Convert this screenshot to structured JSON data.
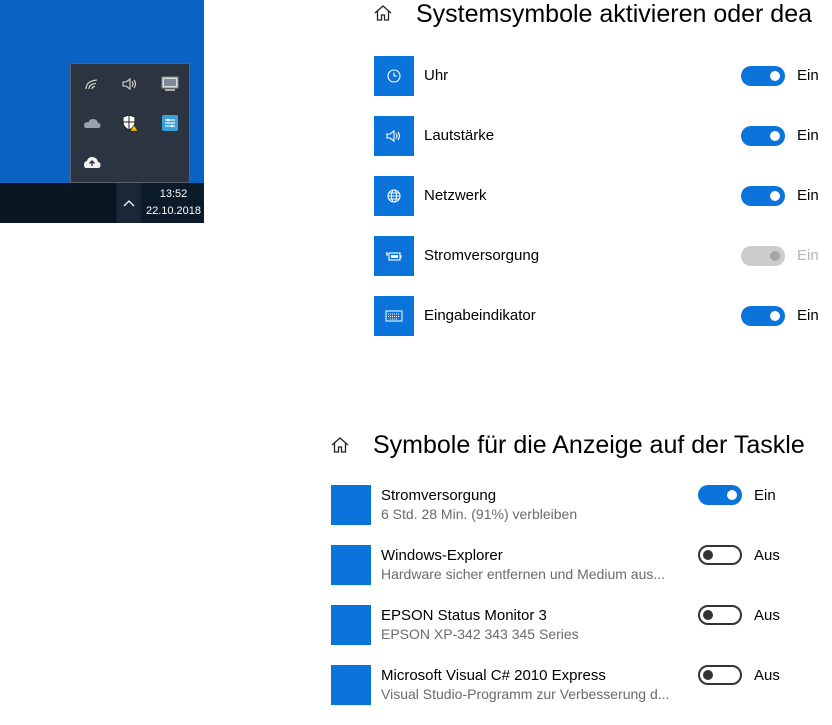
{
  "tray": {
    "time": "13:52",
    "date": "22.10.2018",
    "flyout_icons": [
      "wifi-icon",
      "volume-icon",
      "monitor-icon",
      "onedrive-icon",
      "security-shield-icon",
      "network-app-icon",
      "upload-cloud-icon"
    ]
  },
  "system_icons": {
    "title": "Systemsymbole aktivieren oder dea",
    "items": [
      {
        "label": "Uhr",
        "icon": "clock-icon",
        "state": "Ein",
        "toggle": "on"
      },
      {
        "label": "Lautstärke",
        "icon": "volume-icon",
        "state": "Ein",
        "toggle": "on"
      },
      {
        "label": "Netzwerk",
        "icon": "globe-icon",
        "state": "Ein",
        "toggle": "on"
      },
      {
        "label": "Stromversorgung",
        "icon": "battery-icon",
        "state": "Ein",
        "toggle": "disabled"
      },
      {
        "label": "Eingabeindikator",
        "icon": "keyboard-icon",
        "state": "Ein",
        "toggle": "on"
      }
    ]
  },
  "taskbar_icons": {
    "title": "Symbole für die Anzeige auf der Taskle",
    "items": [
      {
        "label": "Stromversorgung",
        "sub": "6 Std. 28 Min. (91%) verbleiben",
        "state": "Ein",
        "toggle": "on"
      },
      {
        "label": "Windows-Explorer",
        "sub": "Hardware sicher entfernen und Medium aus...",
        "state": "Aus",
        "toggle": "off"
      },
      {
        "label": "EPSON Status Monitor 3",
        "sub": "EPSON XP-342 343 345 Series",
        "state": "Aus",
        "toggle": "off"
      },
      {
        "label": "Microsoft Visual C# 2010 Express",
        "sub": "Visual Studio-Programm zur Verbesserung d...",
        "state": "Aus",
        "toggle": "off"
      }
    ]
  },
  "colors": {
    "accent": "#0a74da",
    "desktop": "#0a63c3",
    "taskbar": "#0c1b2a"
  }
}
